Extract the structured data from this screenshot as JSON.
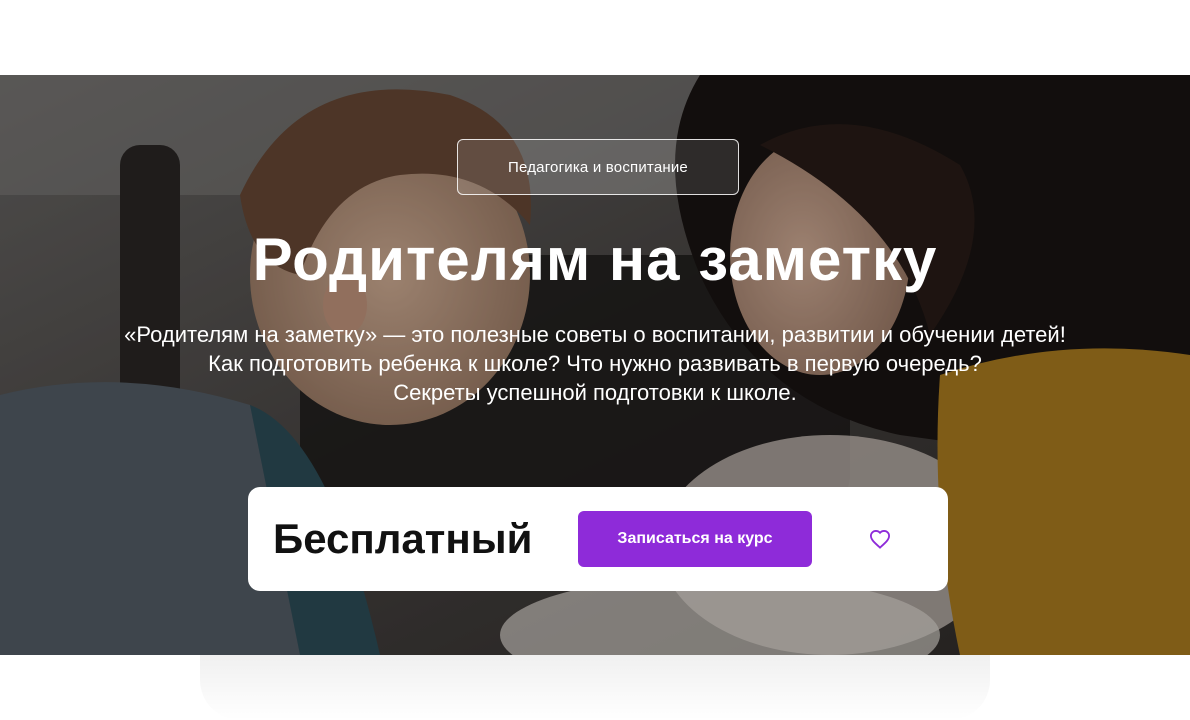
{
  "hero": {
    "category": "Педагогика и воспитание",
    "title": "Родителям на заметку",
    "description_lines": [
      "«Родителям на заметку» — это полезные советы о воспитании, развитии и обучении детей!",
      "Как подготовить ребенка к школе? Что нужно развивать в первую очередь?",
      "Секреты успешной подготовки к школе."
    ]
  },
  "price_card": {
    "price": "Бесплатный",
    "enroll_label": "Записаться на курс",
    "favorite_icon": "heart-outline-icon"
  },
  "colors": {
    "accent": "#8e2bd9",
    "text_on_image": "#ffffff",
    "card_bg": "#ffffff"
  }
}
